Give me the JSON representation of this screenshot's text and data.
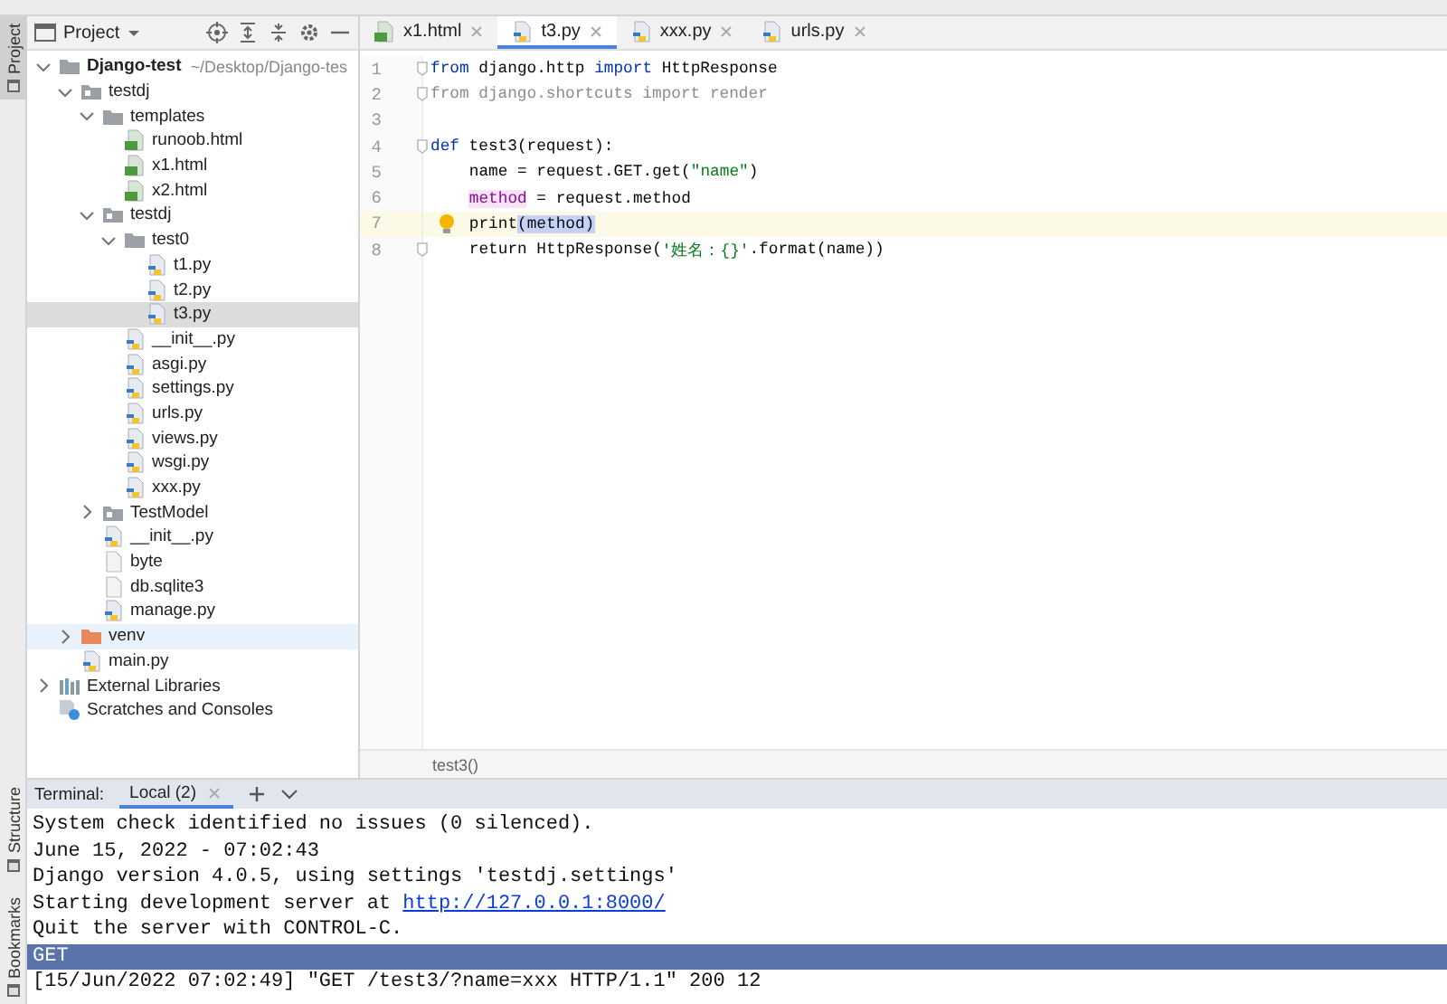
{
  "side_strip": {
    "top": [
      {
        "label": "Project",
        "selected": true
      }
    ],
    "bottom": [
      {
        "label": "Structure",
        "selected": false
      },
      {
        "label": "Bookmarks",
        "selected": false
      }
    ]
  },
  "project_panel": {
    "title": "Project",
    "tree": [
      {
        "label": "Django-test",
        "path": "~/Desktop/Django-tes",
        "kind": "root",
        "expanded": true,
        "selected": false,
        "hovered": false,
        "children": [
          {
            "label": "testdj",
            "kind": "package",
            "expanded": true,
            "selected": false,
            "hovered": false,
            "children": [
              {
                "label": "templates",
                "kind": "folder",
                "expanded": true,
                "selected": false,
                "hovered": false,
                "children": [
                  {
                    "label": "runoob.html",
                    "kind": "html",
                    "selected": false,
                    "hovered": false
                  },
                  {
                    "label": "x1.html",
                    "kind": "html",
                    "selected": false,
                    "hovered": false
                  },
                  {
                    "label": "x2.html",
                    "kind": "html",
                    "selected": false,
                    "hovered": false
                  }
                ]
              },
              {
                "label": "testdj",
                "kind": "package",
                "expanded": true,
                "selected": false,
                "hovered": false,
                "children": [
                  {
                    "label": "test0",
                    "kind": "folder",
                    "expanded": true,
                    "selected": false,
                    "hovered": false,
                    "children": [
                      {
                        "label": "t1.py",
                        "kind": "python",
                        "selected": false,
                        "hovered": false
                      },
                      {
                        "label": "t2.py",
                        "kind": "python",
                        "selected": false,
                        "hovered": false
                      },
                      {
                        "label": "t3.py",
                        "kind": "python",
                        "selected": true,
                        "hovered": false
                      }
                    ]
                  },
                  {
                    "label": "__init__.py",
                    "kind": "python",
                    "selected": false,
                    "hovered": false
                  },
                  {
                    "label": "asgi.py",
                    "kind": "python",
                    "selected": false,
                    "hovered": false
                  },
                  {
                    "label": "settings.py",
                    "kind": "python",
                    "selected": false,
                    "hovered": false
                  },
                  {
                    "label": "urls.py",
                    "kind": "python",
                    "selected": false,
                    "hovered": false
                  },
                  {
                    "label": "views.py",
                    "kind": "python",
                    "selected": false,
                    "hovered": false
                  },
                  {
                    "label": "wsgi.py",
                    "kind": "python",
                    "selected": false,
                    "hovered": false
                  },
                  {
                    "label": "xxx.py",
                    "kind": "python",
                    "selected": false,
                    "hovered": false
                  }
                ]
              },
              {
                "label": "TestModel",
                "kind": "package",
                "expanded": false,
                "selected": false,
                "hovered": false
              },
              {
                "label": "__init__.py",
                "kind": "python",
                "selected": false,
                "hovered": false
              },
              {
                "label": "byte",
                "kind": "text",
                "selected": false,
                "hovered": false
              },
              {
                "label": "db.sqlite3",
                "kind": "text",
                "selected": false,
                "hovered": false
              },
              {
                "label": "manage.py",
                "kind": "python",
                "selected": false,
                "hovered": false
              }
            ]
          },
          {
            "label": "venv",
            "kind": "excluded",
            "expanded": false,
            "selected": false,
            "hovered": true
          },
          {
            "label": "main.py",
            "kind": "python",
            "selected": false,
            "hovered": false
          }
        ]
      },
      {
        "label": "External Libraries",
        "kind": "library",
        "expanded": false,
        "selected": false,
        "hovered": false
      },
      {
        "label": "Scratches and Consoles",
        "kind": "scratches",
        "selected": false,
        "hovered": false
      }
    ]
  },
  "editor": {
    "tabs": [
      {
        "label": "x1.html",
        "kind": "html",
        "selected": false
      },
      {
        "label": "t3.py",
        "kind": "python",
        "selected": true
      },
      {
        "label": "xxx.py",
        "kind": "python",
        "selected": false
      },
      {
        "label": "urls.py",
        "kind": "python",
        "selected": false
      }
    ],
    "lines": [
      {
        "number": "1",
        "current": false,
        "bulb": false,
        "fold": true,
        "indent": false,
        "tokens": [
          {
            "text": "from",
            "kind": "keyword"
          },
          {
            "text": " django.http ",
            "kind": "plain"
          },
          {
            "text": "import",
            "kind": "keyword"
          },
          {
            "text": " HttpResponse",
            "kind": "plain"
          }
        ]
      },
      {
        "number": "2",
        "current": false,
        "bulb": false,
        "fold": true,
        "indent": false,
        "tokens": [
          {
            "text": "from django.shortcuts import render",
            "kind": "unused"
          }
        ]
      },
      {
        "number": "3",
        "current": false,
        "bulb": false,
        "fold": false
      },
      {
        "number": "4",
        "current": false,
        "bulb": false,
        "fold": true,
        "indent": false,
        "tokens": [
          {
            "text": "def",
            "kind": "keyword"
          },
          {
            "text": " test3(request):",
            "kind": "plain"
          }
        ]
      },
      {
        "number": "5",
        "current": false,
        "bulb": false,
        "fold": false,
        "indent": true,
        "tokens": [
          {
            "text": "name = request.GET.get(",
            "kind": "plain"
          },
          {
            "text": "\"name\"",
            "kind": "string"
          },
          {
            "text": ")",
            "kind": "plain"
          }
        ]
      },
      {
        "number": "6",
        "current": false,
        "bulb": false,
        "fold": false,
        "indent": true,
        "tokens": [
          {
            "text": "method",
            "kind": "occurrence"
          },
          {
            "text": " = request.method",
            "kind": "plain"
          }
        ]
      },
      {
        "number": "7",
        "current": true,
        "bulb": true,
        "fold": false,
        "indent": true,
        "tokens": [
          {
            "text": "print",
            "kind": "plain"
          },
          {
            "text": "(method)",
            "kind": "brace-match"
          }
        ]
      },
      {
        "number": "8",
        "current": false,
        "bulb": false,
        "fold": true,
        "indent": true,
        "tokens": [
          {
            "text": "return HttpResponse(",
            "kind": "plain"
          },
          {
            "text": "'姓名：{}'",
            "kind": "string"
          },
          {
            "text": ".format(name))",
            "kind": "plain"
          }
        ]
      }
    ],
    "breadcrumb": "test3()"
  },
  "terminal": {
    "label": "Terminal:",
    "tabs": [
      {
        "label": "Local (2)",
        "selected": true
      }
    ],
    "lines": [
      {
        "highlighted": false,
        "segments": [
          {
            "text": "System check identified no issues (0 silenced).",
            "kind": "text"
          }
        ]
      },
      {
        "highlighted": false,
        "segments": [
          {
            "text": "June 15, 2022 - 07:02:43",
            "kind": "text"
          }
        ]
      },
      {
        "highlighted": false,
        "segments": [
          {
            "text": "Django version 4.0.5, using settings 'testdj.settings'",
            "kind": "text"
          }
        ]
      },
      {
        "highlighted": false,
        "segments": [
          {
            "text": "Starting development server at ",
            "kind": "text"
          },
          {
            "text": "http://127.0.0.1:8000/",
            "kind": "link"
          }
        ]
      },
      {
        "highlighted": false,
        "segments": [
          {
            "text": "Quit the server with CONTROL-C.",
            "kind": "text"
          }
        ]
      },
      {
        "highlighted": true,
        "segments": [
          {
            "text": "GET",
            "kind": "text"
          }
        ]
      },
      {
        "highlighted": false,
        "segments": [
          {
            "text": "[15/Jun/2022 07:02:49] \"GET /test3/?name=xxx HTTP/1.1\" 200 12",
            "kind": "text"
          }
        ]
      }
    ]
  }
}
